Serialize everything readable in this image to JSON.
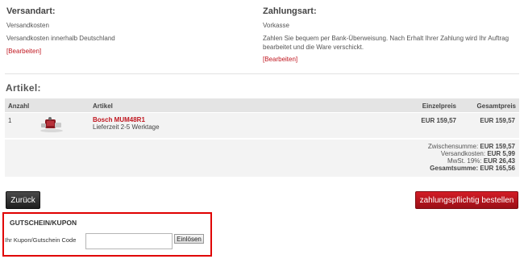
{
  "shipping": {
    "title": "Versandart:",
    "method": "Versandkosten",
    "description": "Versandkosten innerhalb Deutschland",
    "edit_label": "[Bearbeiten]"
  },
  "payment": {
    "title": "Zahlungsart:",
    "method": "Vorkasse",
    "description_line1": "Zahlen Sie bequem per Bank-Überweisung. Nach Erhalt Ihrer Zahlung wird Ihr Auftrag",
    "description_line2": "bearbeitet und die Ware verschickt.",
    "edit_label": "[Bearbeiten]"
  },
  "articles": {
    "title": "Artikel:",
    "columns": {
      "quantity": "Anzahl",
      "article": "Artikel",
      "unit_price": "Einzelpreis",
      "total_price": "Gesamtpreis"
    },
    "items": [
      {
        "quantity": "1",
        "name": "Bosch MUM48R1",
        "delivery": "Lieferzeit 2-5 Werktage",
        "unit_price": "EUR 159,57",
        "total_price": "EUR 159,57"
      }
    ]
  },
  "totals": {
    "subtotal_label": "Zwischensumme:",
    "subtotal_value": "EUR 159,57",
    "shipping_label": "Versandkosten:",
    "shipping_value": "EUR 5,99",
    "tax_label": "MwSt. 19%:",
    "tax_value": "EUR 26,43",
    "grand_label": "Gesamtsumme:",
    "grand_value": "EUR 165,56"
  },
  "buttons": {
    "back": "Zurück",
    "order": "zahlungspflichtig bestellen"
  },
  "coupon": {
    "title": "GUTSCHEIN/KUPON",
    "label": "Ihr Kupon/Gutschein Code",
    "input_value": "",
    "redeem": "Einlösen"
  },
  "colors": {
    "accent": "#c0161f",
    "coupon_border": "#e00000",
    "header_bg": "#e4e4e4",
    "row_bg": "#f3f3f3"
  }
}
